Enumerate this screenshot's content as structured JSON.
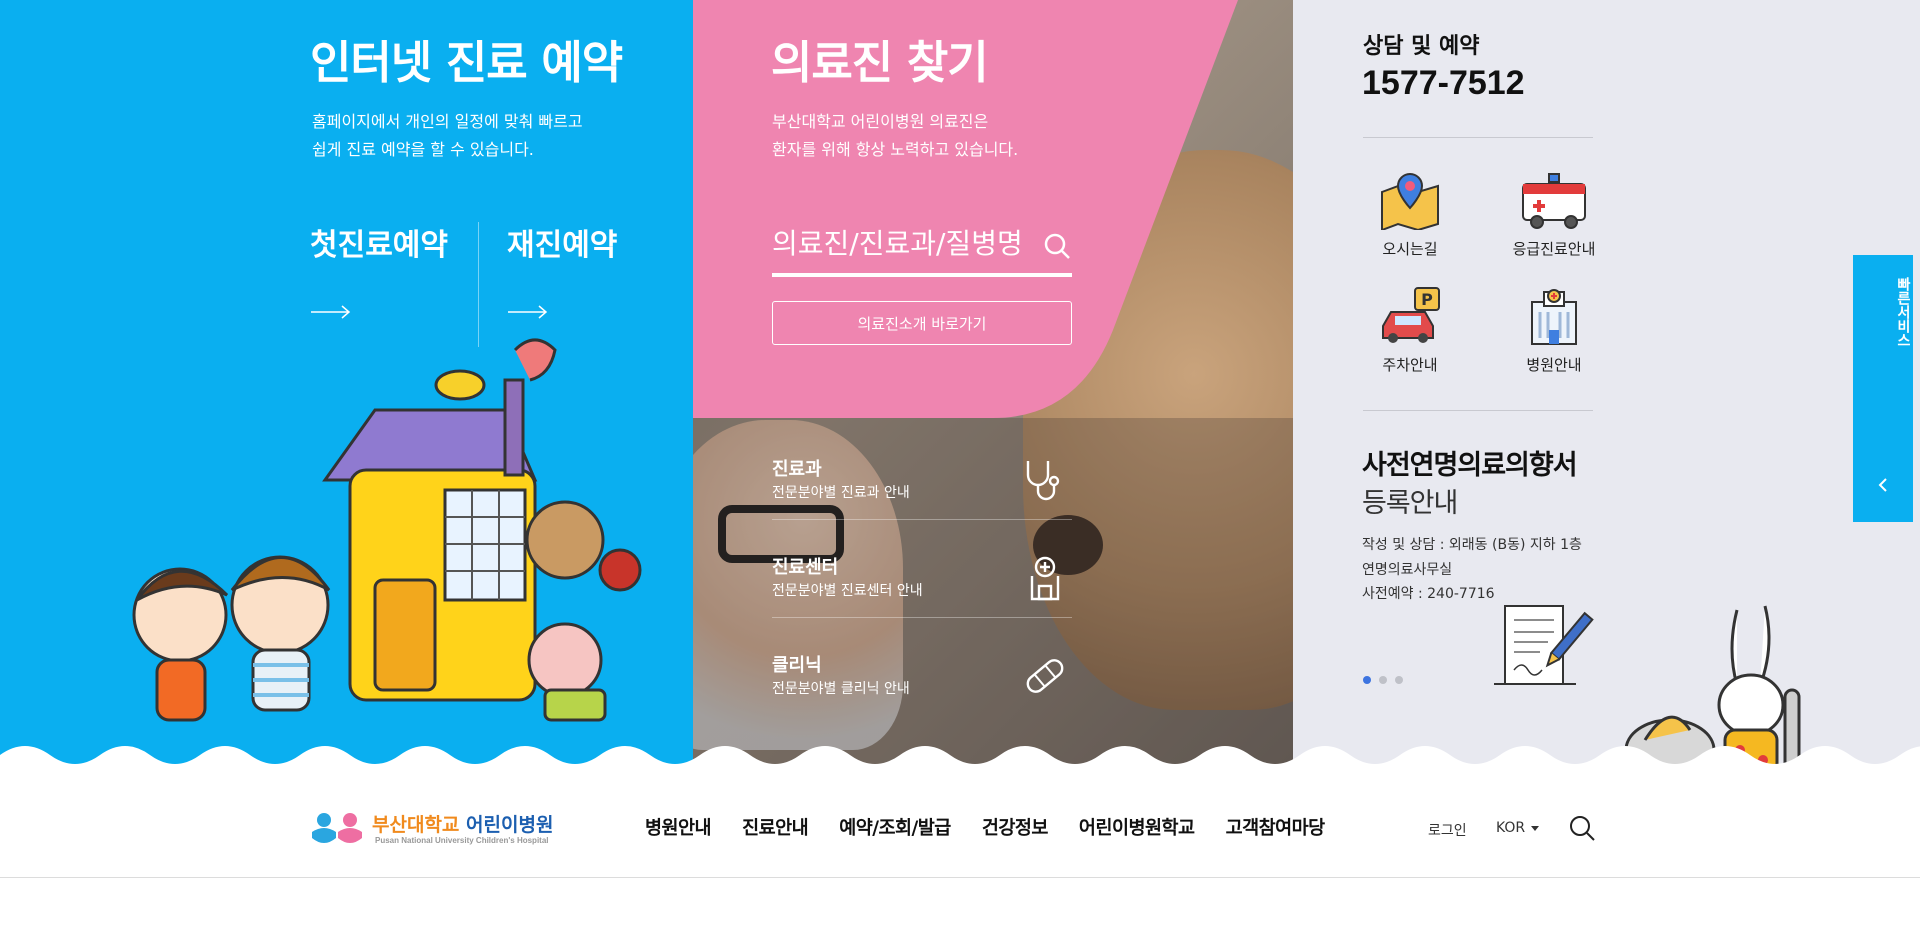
{
  "online_reservation": {
    "title": "인터넷 진료 예약",
    "desc_line1": "홈페이지에서 개인의 일정에 맞춰 빠르고",
    "desc_line2": "쉽게 진료 예약을 할 수 있습니다.",
    "first_visit": "첫진료예약",
    "revisit": "재진예약"
  },
  "find_doctor": {
    "title": "의료진 찾기",
    "desc_line1": "부산대학교 어린이병원 의료진은",
    "desc_line2": "환자를 위해 항상 노력하고 있습니다.",
    "search_placeholder": "의료진/진료과/질병명",
    "intro_button": "의료진소개 바로가기"
  },
  "services": [
    {
      "title": "진료과",
      "subtitle": "전문분야별 진료과 안내",
      "icon": "stethoscope-icon"
    },
    {
      "title": "진료센터",
      "subtitle": "전문분야별 진료센터 안내",
      "icon": "medical-center-icon"
    },
    {
      "title": "클리닉",
      "subtitle": "전문분야별 클리닉 안내",
      "icon": "bandage-icon"
    }
  ],
  "contact": {
    "label": "상담 및 예약",
    "phone": "1577-7512"
  },
  "quick_icons": [
    {
      "label": "오시는길",
      "icon": "map-pin-icon"
    },
    {
      "label": "응급진료안내",
      "icon": "ambulance-icon"
    },
    {
      "label": "주차안내",
      "icon": "parking-car-icon"
    },
    {
      "label": "병원안내",
      "icon": "hospital-building-icon"
    }
  ],
  "advance_directive": {
    "title_line1": "사전연명의료의향서",
    "title_line2": "등록안내",
    "info": [
      "작성 및 상담 : 외래동 (B동) 지하 1층",
      "연명의료사무실",
      "사전예약 : 240-7716"
    ],
    "document_icon": "document-pen-icon",
    "slide_count": 3,
    "active_slide": 1
  },
  "quick_service": {
    "label": "빠른서비스"
  },
  "header": {
    "logo_kr_part1": "부산대학교",
    "logo_kr_part2": "어린이병원",
    "logo_en": "Pusan National University Children's Hospital",
    "nav": [
      "병원안내",
      "진료안내",
      "예약/조회/발급",
      "건강정보",
      "어린이병원학교",
      "고객참여마당"
    ],
    "login": "로그인",
    "language": "KOR"
  },
  "colors": {
    "primary_blue": "#0aaff0",
    "pink": "#ef85b0",
    "panel_grey": "#e8e9f0",
    "logo_orange": "#f08a1d",
    "logo_blue": "#1c5fb0"
  }
}
